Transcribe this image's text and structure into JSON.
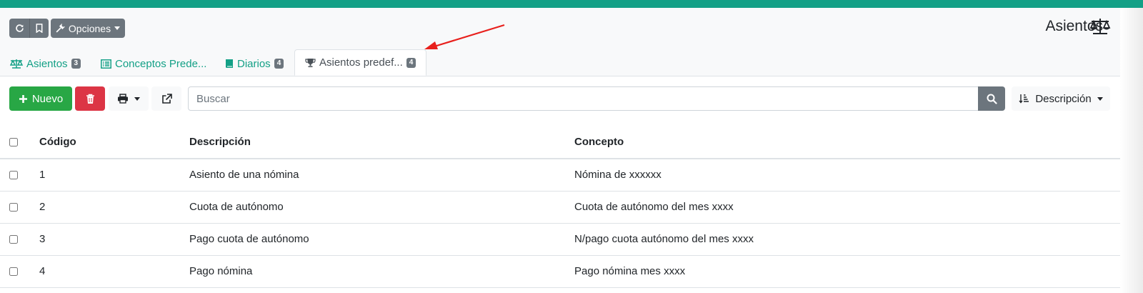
{
  "app": {
    "accent_color": "#13a086"
  },
  "header": {
    "opciones_label": "Opciones",
    "title": "Asientos"
  },
  "tabs": [
    {
      "label": "Asientos",
      "count": "3",
      "icon": "balance-scale-icon"
    },
    {
      "label": "Conceptos Prede...",
      "icon": "list-icon"
    },
    {
      "label": "Diarios",
      "count": "4",
      "icon": "book-icon"
    },
    {
      "label": "Asientos predef...",
      "count": "4",
      "icon": "trophy-icon",
      "active": true
    }
  ],
  "toolbar": {
    "nuevo_label": "Nuevo",
    "search_placeholder": "Buscar",
    "sort_label": "Descripción"
  },
  "table": {
    "columns": [
      "Código",
      "Descripción",
      "Concepto"
    ],
    "rows": [
      {
        "codigo": "1",
        "descripcion": "Asiento de una nómina",
        "concepto": "Nómina de xxxxxx"
      },
      {
        "codigo": "2",
        "descripcion": "Cuota de autónomo",
        "concepto": "Cuota de autónomo del mes xxxx"
      },
      {
        "codigo": "3",
        "descripcion": "Pago cuota de autónomo",
        "concepto": "N/pago cuota autónomo del mes xxxx"
      },
      {
        "codigo": "4",
        "descripcion": "Pago nómina",
        "concepto": "Pago nómina mes xxxx"
      }
    ]
  }
}
